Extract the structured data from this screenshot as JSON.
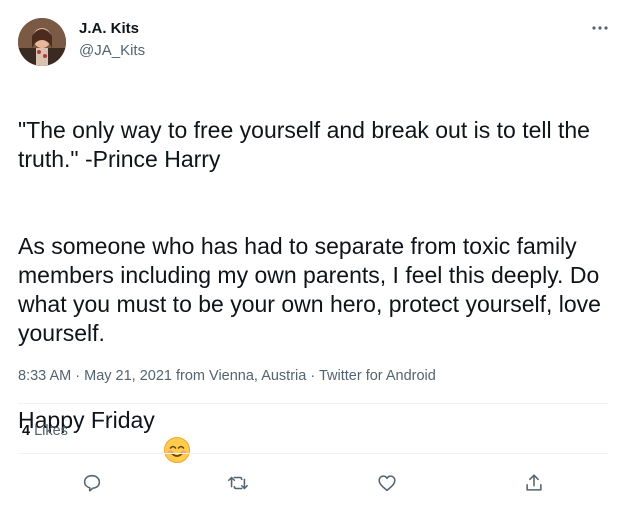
{
  "author": {
    "name": "J.A. Kits",
    "handle": "@JA_Kits"
  },
  "tweet": {
    "quote": "\"The only way to free yourself and break out is to tell the truth.\" -Prince Harry",
    "body": "As someone who has had to separate from toxic family members including my own parents, I feel this deeply. Do what you must to be your own hero, protect yourself, love yourself.",
    "closing": "Happy Friday",
    "emoji": "smiling-face-with-smiling-eyes"
  },
  "meta": {
    "time": "8:33 AM",
    "separator": "·",
    "date": "May 21, 2021",
    "location": "from Vienna, Austria",
    "source": "Twitter for Android"
  },
  "stats": {
    "likes_count": "4",
    "likes_label": "Likes"
  },
  "actions": {
    "reply": "reply-icon",
    "retweet": "retweet-icon",
    "like": "heart-icon",
    "share": "share-icon"
  },
  "colors": {
    "text": "#0f1419",
    "secondary": "#536471",
    "divider": "#eff3f4"
  }
}
